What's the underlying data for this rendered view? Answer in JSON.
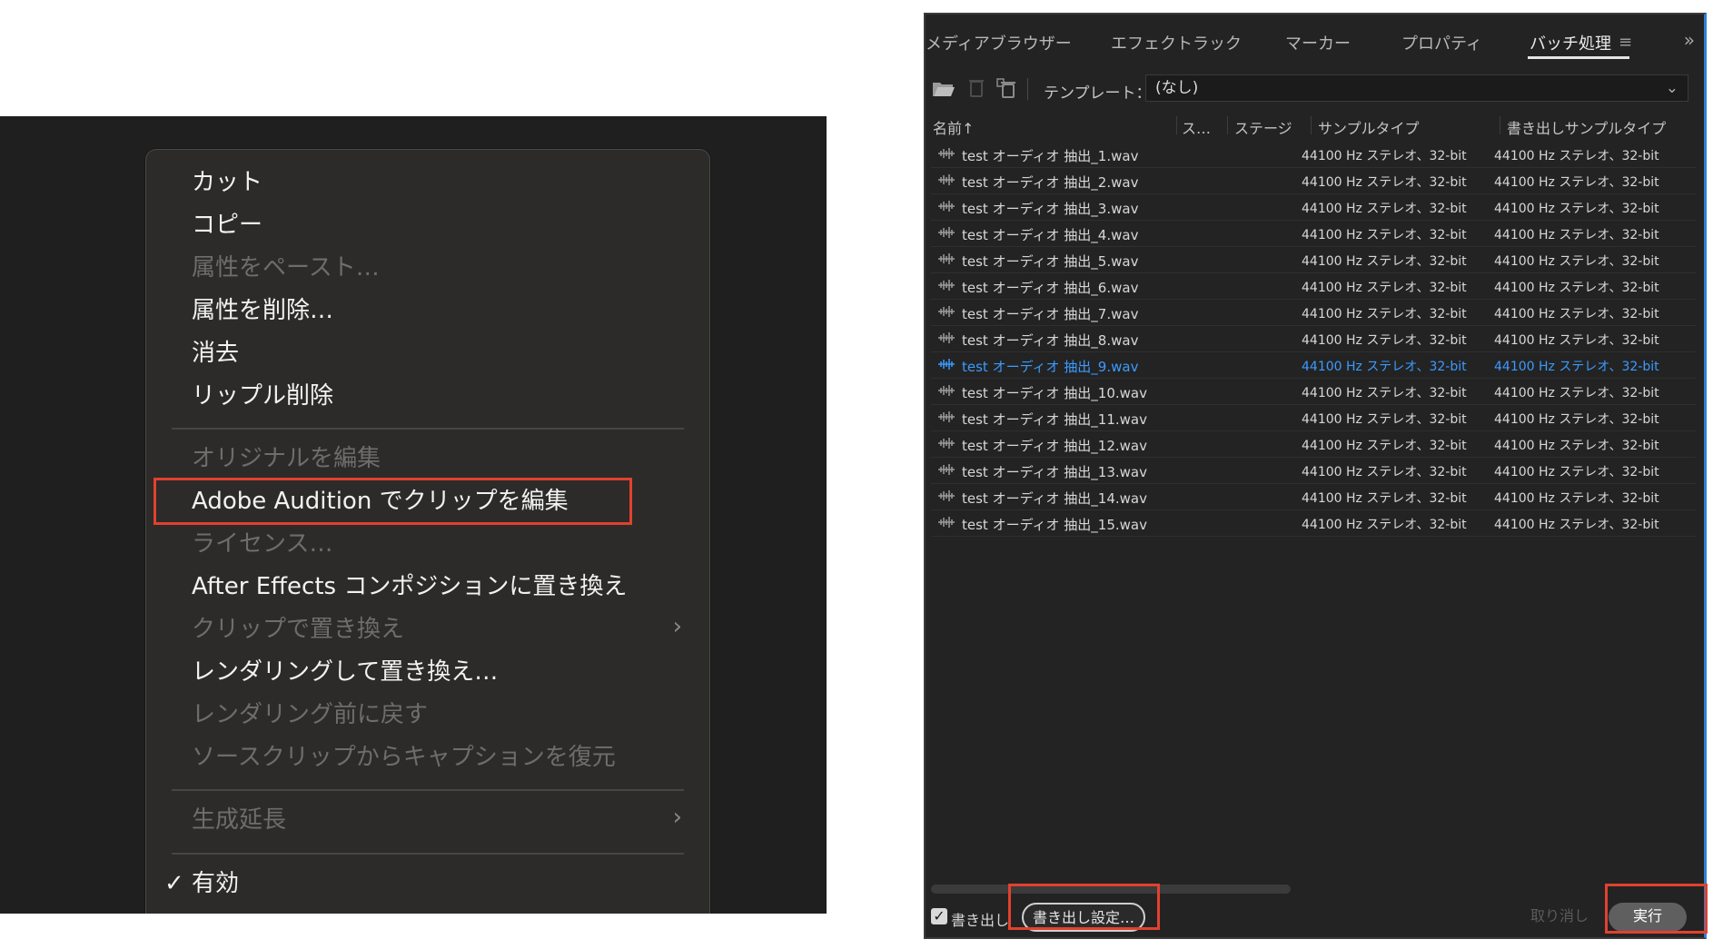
{
  "context_menu": {
    "items": [
      {
        "label": "カット",
        "enabled": true
      },
      {
        "label": "コピー",
        "enabled": true
      },
      {
        "label": "属性をペースト…",
        "enabled": false
      },
      {
        "label": "属性を削除…",
        "enabled": true
      },
      {
        "label": "消去",
        "enabled": true
      },
      {
        "label": "リップル削除",
        "enabled": true
      },
      {
        "label": "オリジナルを編集",
        "enabled": false
      },
      {
        "label": "Adobe Audition でクリップを編集",
        "enabled": true,
        "highlighted": true
      },
      {
        "label": "ライセンス…",
        "enabled": false
      },
      {
        "label": "After Effects コンポジションに置き換え",
        "enabled": true
      },
      {
        "label": "クリップで置き換え",
        "enabled": false,
        "submenu": true
      },
      {
        "label": "レンダリングして置き換え…",
        "enabled": true
      },
      {
        "label": "レンダリング前に戻す",
        "enabled": false
      },
      {
        "label": "ソースクリップからキャプションを復元",
        "enabled": false
      },
      {
        "label": "生成延長",
        "enabled": false,
        "submenu": true
      },
      {
        "label": "有効",
        "enabled": true,
        "checked": true
      }
    ],
    "chevron_glyph": "›",
    "check_glyph": "✓"
  },
  "batch_panel": {
    "tabs": [
      {
        "label": "メディアブラウザー",
        "active": false
      },
      {
        "label": "エフェクトラック",
        "active": false
      },
      {
        "label": "マーカー",
        "active": false
      },
      {
        "label": "プロパティ",
        "active": false
      },
      {
        "label": "バッチ処理",
        "active": true
      }
    ],
    "tab_menu_glyph": "≡",
    "overflow_glyph": "»",
    "toolbar": {
      "icons": [
        "folder-open-icon",
        "trash-icon",
        "clear-all-icon"
      ],
      "template_label": "テンプレート：",
      "template_value": "(なし)"
    },
    "columns": {
      "name": "名前",
      "name_sort_glyph": "↑",
      "status": "ス…",
      "stage": "ステージ",
      "sample_type": "サンプルタイプ",
      "export_sample_type": "書き出しサンプルタイプ"
    },
    "rows": [
      {
        "name": "test オーディオ 抽出_1.wav",
        "sample_type": "44100 Hz ステレオ、32-bit",
        "export_sample_type": "44100 Hz ステレオ、32-bit"
      },
      {
        "name": "test オーディオ 抽出_2.wav",
        "sample_type": "44100 Hz ステレオ、32-bit",
        "export_sample_type": "44100 Hz ステレオ、32-bit"
      },
      {
        "name": "test オーディオ 抽出_3.wav",
        "sample_type": "44100 Hz ステレオ、32-bit",
        "export_sample_type": "44100 Hz ステレオ、32-bit"
      },
      {
        "name": "test オーディオ 抽出_4.wav",
        "sample_type": "44100 Hz ステレオ、32-bit",
        "export_sample_type": "44100 Hz ステレオ、32-bit"
      },
      {
        "name": "test オーディオ 抽出_5.wav",
        "sample_type": "44100 Hz ステレオ、32-bit",
        "export_sample_type": "44100 Hz ステレオ、32-bit"
      },
      {
        "name": "test オーディオ 抽出_6.wav",
        "sample_type": "44100 Hz ステレオ、32-bit",
        "export_sample_type": "44100 Hz ステレオ、32-bit"
      },
      {
        "name": "test オーディオ 抽出_7.wav",
        "sample_type": "44100 Hz ステレオ、32-bit",
        "export_sample_type": "44100 Hz ステレオ、32-bit"
      },
      {
        "name": "test オーディオ 抽出_8.wav",
        "sample_type": "44100 Hz ステレオ、32-bit",
        "export_sample_type": "44100 Hz ステレオ、32-bit"
      },
      {
        "name": "test オーディオ 抽出_9.wav",
        "sample_type": "44100 Hz ステレオ、32-bit",
        "export_sample_type": "44100 Hz ステレオ、32-bit",
        "selected": true
      },
      {
        "name": "test オーディオ 抽出_10.wav",
        "sample_type": "44100 Hz ステレオ、32-bit",
        "export_sample_type": "44100 Hz ステレオ、32-bit"
      },
      {
        "name": "test オーディオ 抽出_11.wav",
        "sample_type": "44100 Hz ステレオ、32-bit",
        "export_sample_type": "44100 Hz ステレオ、32-bit"
      },
      {
        "name": "test オーディオ 抽出_12.wav",
        "sample_type": "44100 Hz ステレオ、32-bit",
        "export_sample_type": "44100 Hz ステレオ、32-bit"
      },
      {
        "name": "test オーディオ 抽出_13.wav",
        "sample_type": "44100 Hz ステレオ、32-bit",
        "export_sample_type": "44100 Hz ステレオ、32-bit"
      },
      {
        "name": "test オーディオ 抽出_14.wav",
        "sample_type": "44100 Hz ステレオ、32-bit",
        "export_sample_type": "44100 Hz ステレオ、32-bit"
      },
      {
        "name": "test オーディオ 抽出_15.wav",
        "sample_type": "44100 Hz ステレオ、32-bit",
        "export_sample_type": "44100 Hz ステレオ、32-bit"
      }
    ],
    "footer": {
      "export_checked": true,
      "export_label": "書き出し",
      "export_settings_button": "書き出し設定…",
      "cancel_button": "取り消し",
      "run_button": "実行"
    },
    "accent_color": "#3b9bff",
    "highlight_color": "#e2412e"
  }
}
